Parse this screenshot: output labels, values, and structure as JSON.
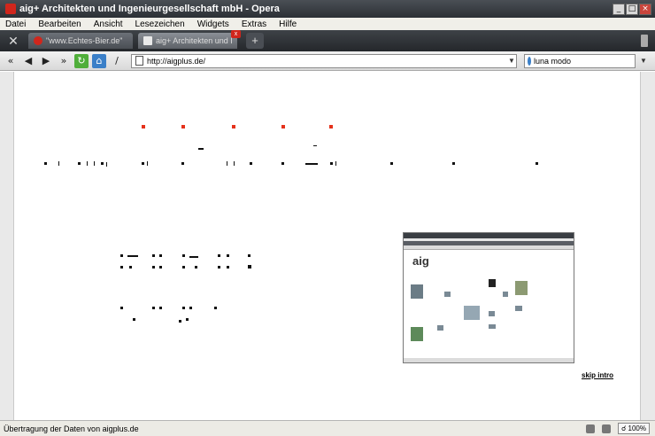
{
  "window": {
    "title": "aig+ Architekten und Ingenieurgesellschaft mbH - Opera"
  },
  "menu": [
    "Datei",
    "Bearbeiten",
    "Ansicht",
    "Lesezeichen",
    "Widgets",
    "Extras",
    "Hilfe"
  ],
  "tabs": [
    {
      "label": "\"www.Echtes-Bier.de\"",
      "active": false
    },
    {
      "label": "aig+ Architekten und Ing...",
      "active": true
    }
  ],
  "address": {
    "url": "http://aigplus.de/"
  },
  "search": {
    "value": "luna modo"
  },
  "page": {
    "skip_link": "skip intro"
  },
  "status": {
    "text": "Übertragung der Daten von aigplus.de",
    "zoom": "100%"
  },
  "colors": {
    "accent_red": "#e5321b",
    "titlebar": "#2c3035"
  }
}
